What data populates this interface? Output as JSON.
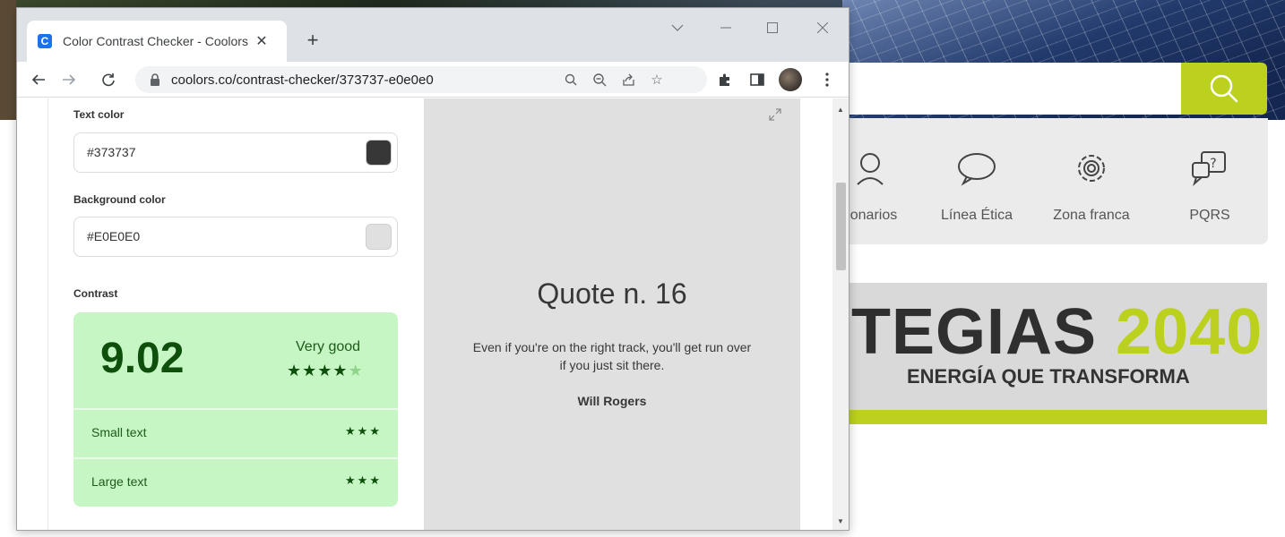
{
  "background_site": {
    "nav_items": [
      {
        "label": "onarios",
        "icon": "person-icon"
      },
      {
        "label": "Línea Ética",
        "icon": "speech-bubble-icon"
      },
      {
        "label": "Zona franca",
        "icon": "gear-icon"
      },
      {
        "label": "PQRS",
        "icon": "question-bubble-icon"
      }
    ],
    "banner_title_dark": "TEGIAS",
    "banner_title_accent": "2040",
    "banner_subtitle": "ENERGÍA QUE TRANSFORMA",
    "accent_color": "#bcd11e"
  },
  "browser": {
    "tab_title": "Color Contrast Checker - Coolors",
    "tab_favicon": "C",
    "url": "coolors.co/contrast-checker/373737-e0e0e0"
  },
  "checker": {
    "text_color_label": "Text color",
    "text_color_value": "#373737",
    "background_color_label": "Background color",
    "background_color_value": "#E0E0E0",
    "contrast_label": "Contrast",
    "ratio": "9.02",
    "rating": "Very good",
    "rating_stars": 4,
    "rating_stars_max": 5,
    "small_text_label": "Small text",
    "small_text_stars": "★★★",
    "large_text_label": "Large text",
    "large_text_stars": "★★★",
    "card_color": "#c6f6c4"
  },
  "preview": {
    "title": "Quote n. 16",
    "quote": "Even if you're on the right track, you'll get run over if you just sit there.",
    "author": "Will Rogers",
    "text_color": "#373737",
    "background_color": "#e0e0e0"
  }
}
